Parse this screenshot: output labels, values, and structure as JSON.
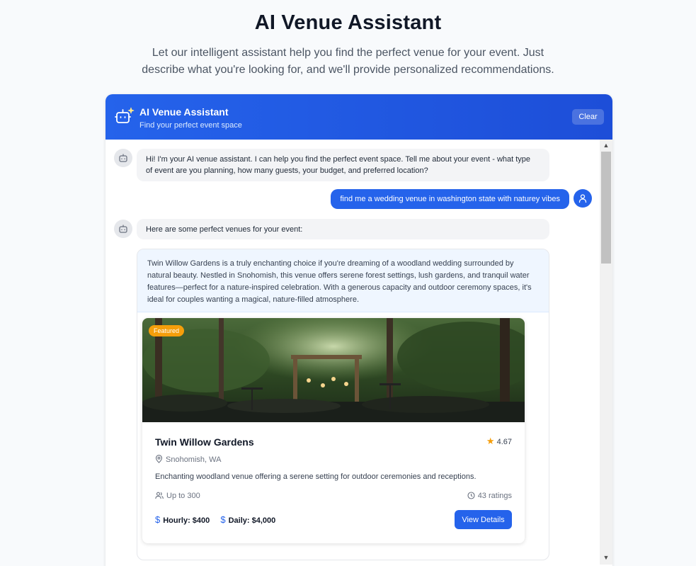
{
  "page": {
    "title": "AI Venue Assistant",
    "subtitle_line1": "Let our intelligent assistant help you find the perfect venue for your event. Just",
    "subtitle_line2": "describe what you're looking for, and we'll provide personalized recommendations."
  },
  "chat": {
    "header": {
      "icon": "robot-sparkle-icon",
      "title": "AI Venue Assistant",
      "subtitle": "Find your perfect event space",
      "clear_label": "Clear"
    },
    "messages": [
      {
        "role": "assistant",
        "icon": "bot-icon",
        "line1": "Hi! I'm your AI venue assistant. I can help you find the perfect event space. Tell me about your event - what type",
        "line2": "of event are you planning, how many guests, your budget, and preferred location?"
      },
      {
        "role": "user",
        "icon": "user-icon",
        "text": "find me a wedding venue in washington state with naturey vibes"
      },
      {
        "role": "assistant",
        "icon": "bot-icon",
        "text": "Here are some perfect venues for your event:"
      }
    ],
    "recommendation": {
      "summary": "Twin Willow Gardens is a truly enchanting choice if you're dreaming of a woodland wedding surrounded by natural beauty. Nestled in Snohomish, this venue offers serene forest settings, lush gardens, and tranquil water features—perfect for a nature-inspired celebration. With a generous capacity and outdoor ceremony spaces, it's ideal for couples wanting a magical, nature-filled atmosphere.",
      "venue": {
        "badge": "Featured",
        "name": "Twin Willow Gardens",
        "rating": "4.67",
        "location": "Snohomish, WA",
        "description": "Enchanting woodland venue offering a serene setting for outdoor ceremonies and receptions.",
        "capacity": "Up to 300",
        "reviews": "43 ratings",
        "hourly_label": "Hourly:",
        "hourly_value": "$400",
        "daily_label": "Daily:",
        "daily_value": "$4,000",
        "button_label": "View Details"
      }
    }
  },
  "colors": {
    "primary": "#2563eb",
    "badge": "#f59e0b",
    "summary_bg": "#eff6ff"
  }
}
